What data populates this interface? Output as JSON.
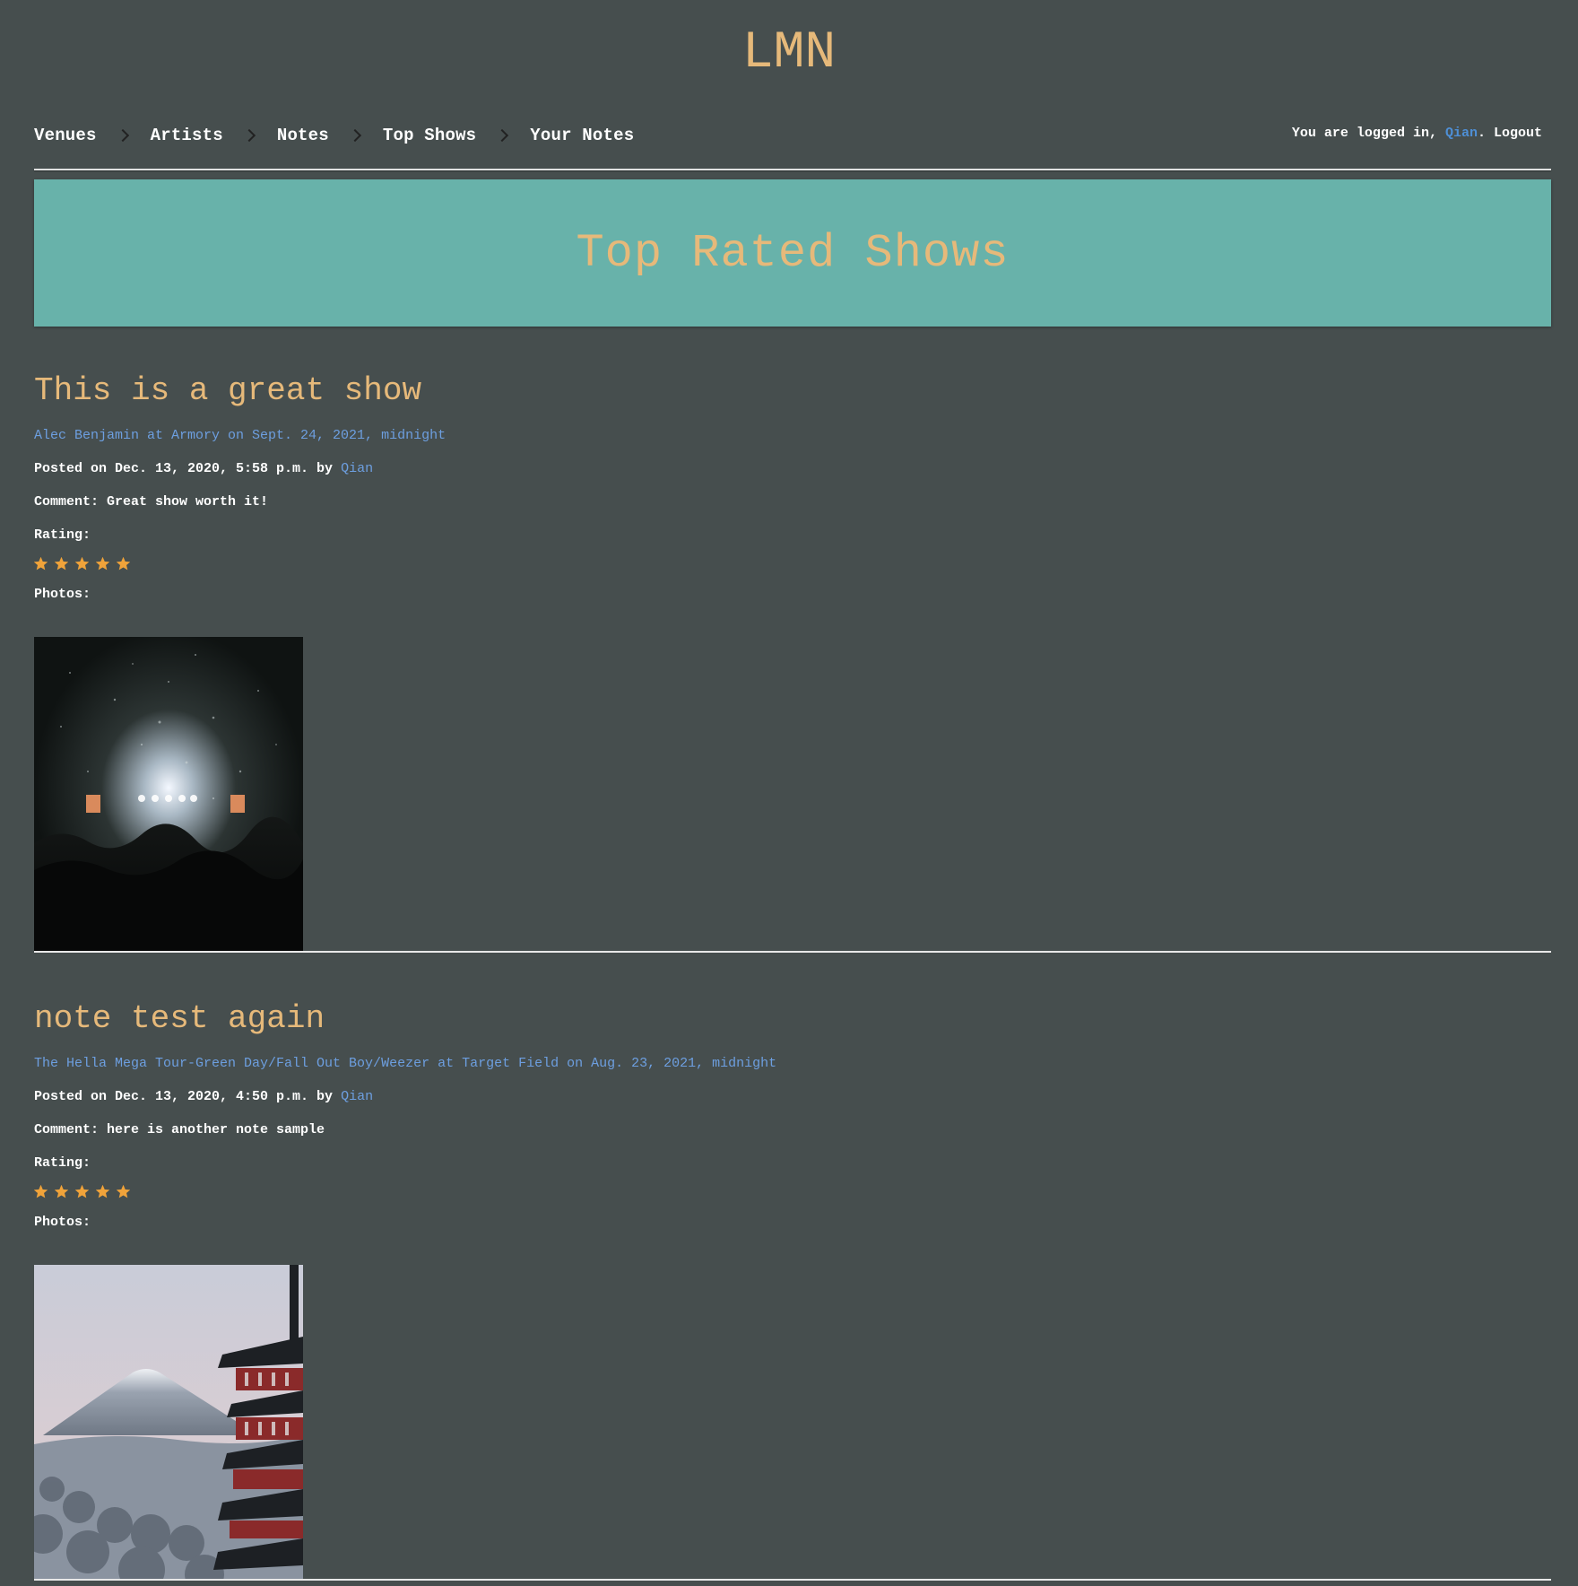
{
  "site": {
    "title": "LMN"
  },
  "nav": {
    "items": [
      {
        "label": "Venues"
      },
      {
        "label": "Artists"
      },
      {
        "label": "Notes"
      },
      {
        "label": "Top Shows"
      },
      {
        "label": "Your Notes"
      }
    ]
  },
  "login": {
    "prefix": "You are logged in, ",
    "username": "Qian",
    "suffix": ". ",
    "logout_label": "Logout"
  },
  "banner": {
    "title": "Top Rated Shows"
  },
  "colors": {
    "background": "#464e4e",
    "accent_gold": "#e6b97a",
    "banner_teal": "#68b2aa",
    "link_blue": "#6d9fe0",
    "star_orange": "#f0a33a"
  },
  "notes": [
    {
      "title": "This is a great show",
      "show_link": "Alec Benjamin at Armory on Sept. 24, 2021, midnight",
      "posted_prefix": "Posted on Dec. 13, 2020, 5:58 p.m. by ",
      "posted_user": "Qian",
      "comment": "Comment: Great show worth it!",
      "rating_label": "Rating:",
      "rating": 5,
      "photos_label": "Photos:",
      "photo_icon": "concert-photo"
    },
    {
      "title": "note test again",
      "show_link": "The Hella Mega Tour-Green Day/Fall Out Boy/Weezer at Target Field on Aug. 23, 2021, midnight",
      "posted_prefix": "Posted on Dec. 13, 2020, 4:50 p.m. by ",
      "posted_user": "Qian",
      "comment": "Comment: here is another note sample",
      "rating_label": "Rating:",
      "rating": 5,
      "photos_label": "Photos:",
      "photo_icon": "mountain-pagoda-photo"
    }
  ]
}
